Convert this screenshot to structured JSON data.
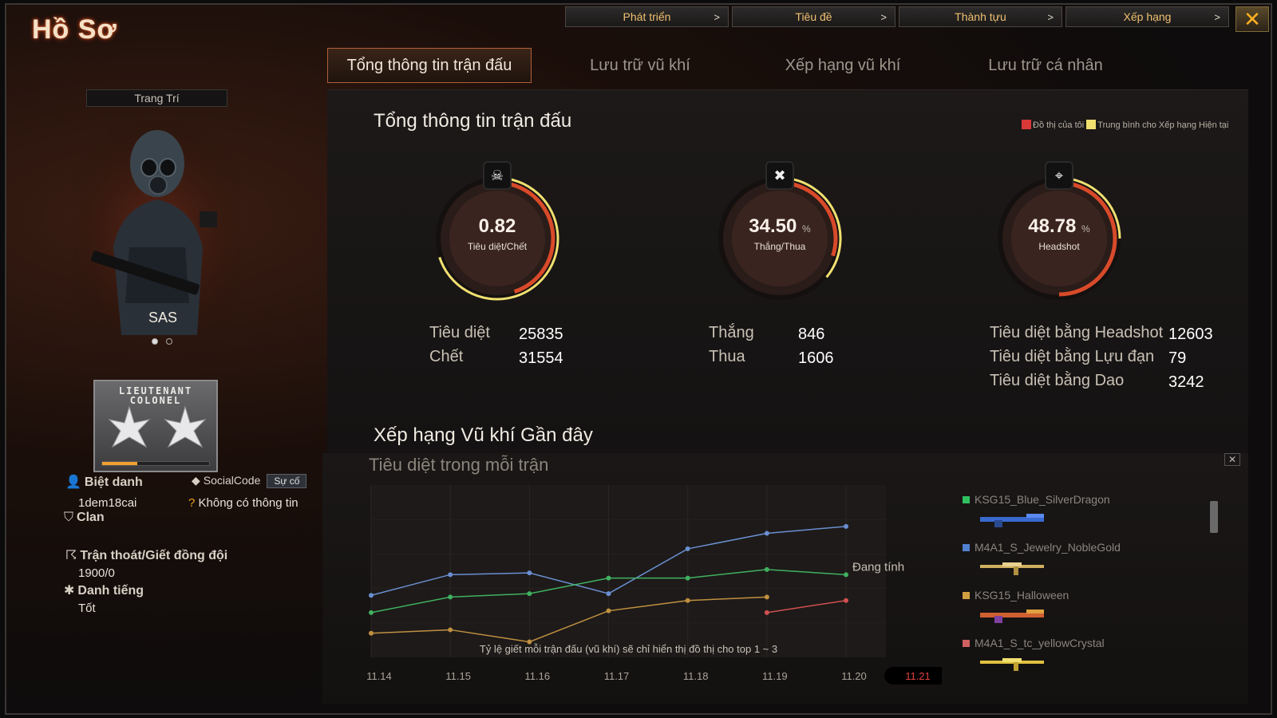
{
  "title": "Hồ Sơ",
  "top_menu": [
    {
      "label": "Phát triển",
      "arrow": ">"
    },
    {
      "label": "Tiêu đề",
      "arrow": ">"
    },
    {
      "label": "Thành tựu",
      "arrow": ">"
    },
    {
      "label": "Xếp hạng",
      "arrow": ">"
    }
  ],
  "close_glyph": "✕",
  "tabs": [
    {
      "label": "Tổng thông tin trận đấu",
      "active": true
    },
    {
      "label": "Lưu trữ vũ khí"
    },
    {
      "label": "Xếp hạng vũ khí"
    },
    {
      "label": "Lưu trữ cá nhân"
    }
  ],
  "left": {
    "decorate_button": "Trang Trí",
    "character": "SAS",
    "rank_title": "LIEUTENANT COLONEL",
    "rank_progress": 0.33,
    "nickname_label": "Biệt danh",
    "nickname": "1dem18cai",
    "social_code_label": "SocialCode",
    "report_button": "Sự cố",
    "social_code_value": "Không có thông tin",
    "clan_label": "Clan",
    "escape_label": "Trận thoát/Giết đồng đội",
    "escape_value": "1900/0",
    "reputation_label": "Danh tiếng",
    "reputation_value": "Tốt"
  },
  "summary": {
    "heading": "Tổng thông tin trận đấu",
    "legend_mine": "Đồ thị của tôi",
    "legend_avg": "Trung bình cho Xếp hạng Hiện tại",
    "legend_colors": {
      "mine": "#d83838",
      "avg": "#f0e070"
    },
    "gauges": [
      {
        "value": "0.82",
        "unit": "",
        "label": "Tiêu diệt/Chết",
        "icon": "skull-icon",
        "fill": 0.45,
        "avg": 0.7
      },
      {
        "value": "34.50",
        "unit": "%",
        "label": "Thắng/Thua",
        "icon": "crossed-guns-icon",
        "fill": 0.3,
        "avg": 0.36
      },
      {
        "value": "48.78",
        "unit": "%",
        "label": "Headshot",
        "icon": "headshot-icon",
        "fill": 0.5,
        "avg": 0.25
      }
    ],
    "kill_label": "Tiêu diệt",
    "kill": "25835",
    "death_label": "Chết",
    "death": "31554",
    "win_label": "Thắng",
    "win": "846",
    "lose_label": "Thua",
    "lose": "1606",
    "hs_label": "Tiêu diệt bằng Headshot",
    "hs": "12603",
    "grenade_label": "Tiêu diệt bằng Lựu đạn",
    "grenade": "79",
    "knife_label": "Tiêu diệt bằng Dao",
    "knife": "3242"
  },
  "weapons": {
    "heading": "Xếp hạng Vũ khí Gần đây",
    "subheading": "Tiêu diệt trong mỗi trận",
    "computing": "Đang tính",
    "note": "Tỷ lệ giết mỗi trận đấu (vũ khí) sẽ chỉ hiển thị đồ thị cho top 1 ~ 3",
    "close_glyph": "✕",
    "list": [
      {
        "name": "KSG15_Blue_SilverDragon",
        "color": "#30c060"
      },
      {
        "name": "M4A1_S_Jewelry_NobleGold",
        "color": "#5080d0"
      },
      {
        "name": "KSG15_Halloween",
        "color": "#d0a040"
      },
      {
        "name": "M4A1_S_tc_yellowCrystal",
        "color": "#d06060"
      }
    ]
  },
  "chart_data": {
    "type": "line",
    "title": "Tiêu diệt trong mỗi trận",
    "x": [
      "11.14",
      "11.15",
      "11.16",
      "11.17",
      "11.18",
      "11.19",
      "11.20",
      "11.21"
    ],
    "highlight_x": "11.21",
    "ylim": [
      0,
      10
    ],
    "grid": true,
    "series": [
      {
        "color": "#6a8fd0",
        "values": [
          3.6,
          4.8,
          4.9,
          3.7,
          6.3,
          7.2,
          7.6,
          null
        ]
      },
      {
        "color": "#40b060",
        "values": [
          2.6,
          3.5,
          3.7,
          4.6,
          4.6,
          5.1,
          4.8,
          null
        ]
      },
      {
        "color": "#c09040",
        "values": [
          1.4,
          1.6,
          0.9,
          2.7,
          3.3,
          3.5,
          null,
          null
        ]
      },
      {
        "color": "#d05050",
        "values": [
          null,
          null,
          null,
          null,
          null,
          2.6,
          3.3,
          null
        ]
      }
    ]
  }
}
